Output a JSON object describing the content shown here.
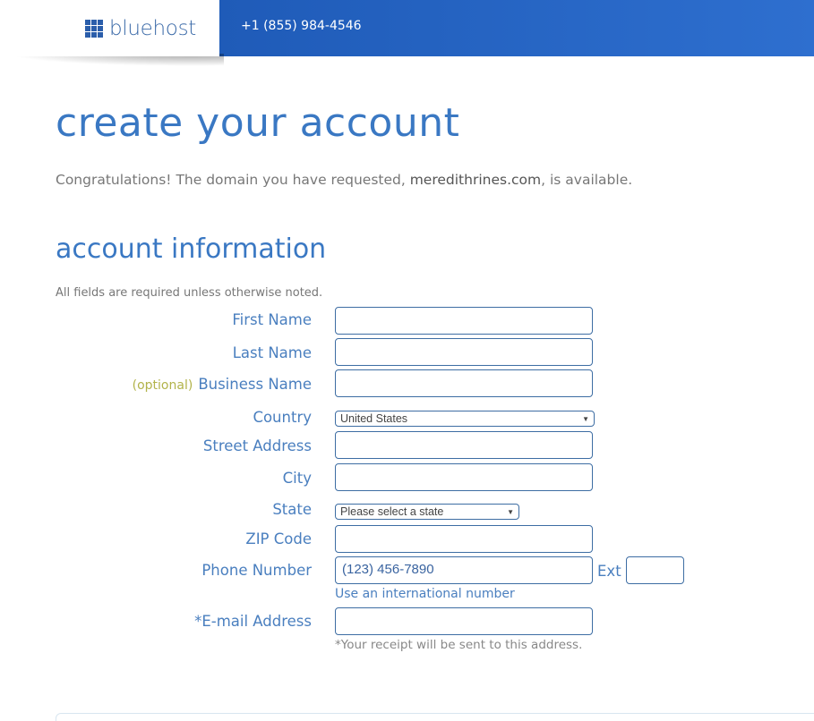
{
  "header": {
    "logo_text": "bluehost",
    "phone": "+1 (855) 984-4546",
    "brand_color": "#2563c2"
  },
  "page": {
    "title": "create your account",
    "congrats_prefix": "Congratulations! The domain you have requested, ",
    "domain": "meredithrines.com",
    "congrats_suffix": ", is available."
  },
  "section": {
    "title": "account information",
    "required_note": "All fields are required unless otherwise noted."
  },
  "form": {
    "first_name": {
      "label": "First Name",
      "value": ""
    },
    "last_name": {
      "label": "Last Name",
      "value": ""
    },
    "business_name": {
      "optional": "(optional)",
      "label": "Business Name",
      "value": ""
    },
    "country": {
      "label": "Country",
      "selected": "United States"
    },
    "street": {
      "label": "Street Address",
      "value": ""
    },
    "city": {
      "label": "City",
      "value": ""
    },
    "state": {
      "label": "State",
      "selected": "Please select a state"
    },
    "zip": {
      "label": "ZIP Code",
      "value": ""
    },
    "phone": {
      "label": "Phone Number",
      "value": "(123) 456-7890",
      "ext_label": "Ext",
      "ext_value": "",
      "intl_link": "Use an international number"
    },
    "email": {
      "label": "*E-mail Address",
      "value": "",
      "note": "*Your receipt will be sent to this address."
    }
  }
}
